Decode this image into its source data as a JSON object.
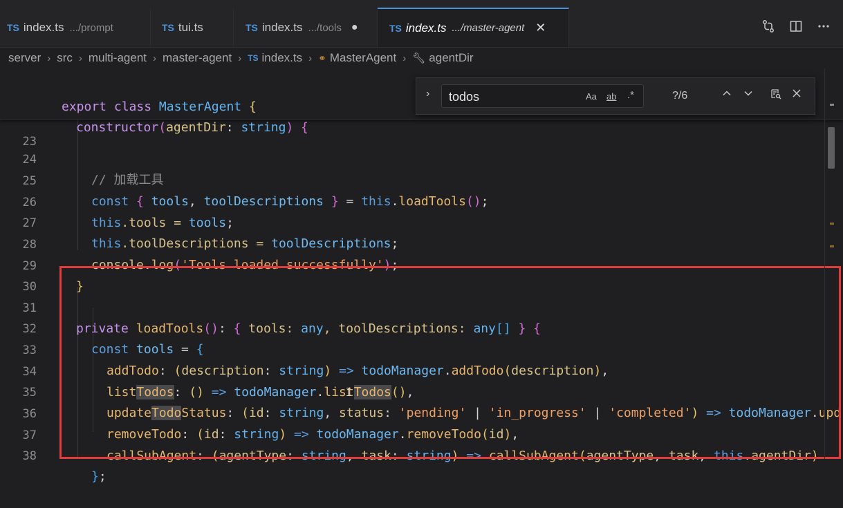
{
  "tabs": [
    {
      "lang": "TS",
      "name": "index.ts",
      "path": ".../prompt"
    },
    {
      "lang": "TS",
      "name": "tui.ts",
      "path": ""
    },
    {
      "lang": "TS",
      "name": "index.ts",
      "path": ".../tools",
      "modified_dot": "●"
    },
    {
      "lang": "TS",
      "name": "index.ts",
      "path": ".../master-agent",
      "close": "✕"
    }
  ],
  "breadcrumb": {
    "items": [
      "server",
      "src",
      "multi-agent",
      "master-agent"
    ],
    "file_lang": "TS",
    "file": "index.ts",
    "class": "MasterAgent",
    "member": "agentDir",
    "separator": "›"
  },
  "find": {
    "value": "todos",
    "match_case": "Aa",
    "whole_word": "ab",
    "regex": ".*",
    "count": "?/6"
  },
  "sticky": {
    "line1": {
      "kw1": "export",
      "kw2": "class",
      "name": "MasterAgent",
      "brace": "{"
    },
    "line2": {
      "fn": "constructor",
      "open": "(",
      "param": "agentDir",
      "colon": ":",
      "type": "string",
      "close": ")",
      "brace": "{"
    }
  },
  "code_lines": [
    {
      "num": "23"
    },
    {
      "num": "24",
      "comment": "// 加载工具"
    },
    {
      "num": "25",
      "t": [
        "const",
        "{",
        "tools",
        ",",
        "toolDescriptions",
        "}",
        "=",
        "this",
        ".",
        "loadTools",
        "(",
        ")",
        ";"
      ]
    },
    {
      "num": "26",
      "t": [
        "this",
        ".tools = ",
        "tools",
        ";"
      ]
    },
    {
      "num": "27",
      "t": [
        "this",
        ".toolDescriptions = ",
        "toolDescriptions",
        ";"
      ]
    },
    {
      "num": "28",
      "t": [
        "console",
        ".",
        "log",
        "(",
        "'Tools loaded successfully'",
        ")",
        ";"
      ]
    },
    {
      "num": "29",
      "t": [
        "}"
      ]
    },
    {
      "num": "30"
    },
    {
      "num": "31",
      "t": [
        "private",
        "loadTools",
        "(",
        ")",
        ": ",
        "{",
        " tools: ",
        "any",
        ", toolDescriptions: ",
        "any",
        "[",
        "]",
        " ",
        "}",
        " ",
        "{"
      ]
    },
    {
      "num": "32",
      "t": [
        "const",
        "tools",
        " = ",
        "{"
      ]
    },
    {
      "num": "33",
      "t": [
        "addTodo",
        ": ",
        "(",
        "description",
        ": ",
        "string",
        ")",
        " => ",
        "todoManager",
        ".",
        "addTodo",
        "(",
        "description",
        ")",
        ","
      ]
    },
    {
      "num": "34",
      "t": [
        "list",
        "Todos",
        ": ",
        "(",
        ")",
        " => ",
        "todoManager",
        ".",
        "list",
        "Todos",
        "(",
        ")",
        ","
      ]
    },
    {
      "num": "35",
      "t": [
        "update",
        "Todo",
        "Status",
        ": ",
        "(",
        "id",
        ": ",
        "string",
        ", ",
        "status",
        ": ",
        "'pending'",
        " | ",
        "'in_progress'",
        " | ",
        "'completed'",
        ")",
        " => ",
        "todoManager",
        ".",
        "upd"
      ]
    },
    {
      "num": "36",
      "t": [
        "removeTodo",
        ": ",
        "(",
        "id",
        ": ",
        "string",
        ")",
        " => ",
        "todoManager",
        ".",
        "removeTodo",
        "(",
        "id",
        ")",
        ","
      ]
    },
    {
      "num": "37",
      "t": [
        "callSubAgent",
        ": ",
        "(",
        "agentType",
        ": ",
        "string",
        ", ",
        "task",
        ": ",
        "string",
        ")",
        " => ",
        "callSubAgent",
        "(",
        "agentType",
        ", ",
        "task",
        ", ",
        "this",
        ".",
        "agentDir",
        ")"
      ]
    },
    {
      "num": "38",
      "t": [
        "}",
        ";"
      ]
    }
  ],
  "colors": {
    "accent": "#4d93d9",
    "highlight_box": "#e03c3c",
    "editor_bg": "#1f1f22"
  }
}
